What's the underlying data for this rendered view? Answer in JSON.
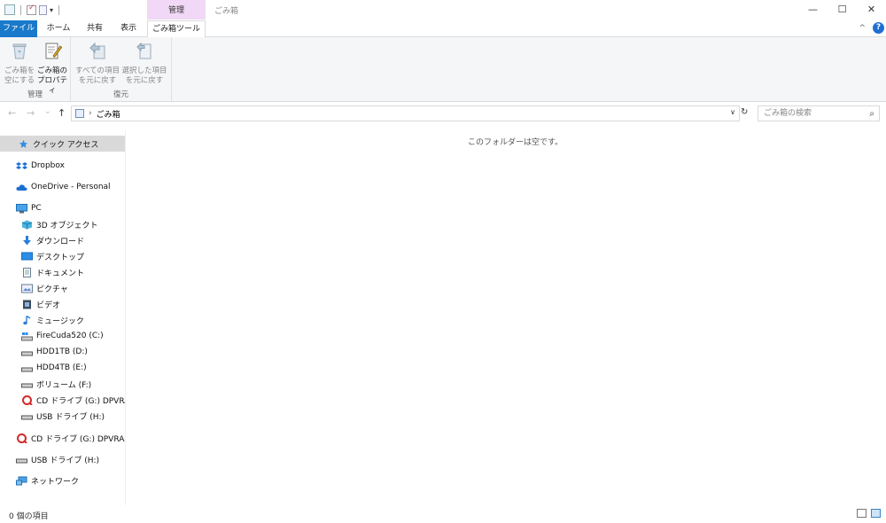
{
  "titlebar": {
    "context_header": "管理",
    "window_title": "ごみ箱",
    "minimize": "—",
    "maximize": "☐",
    "close": "✕"
  },
  "tabs": {
    "file": "ファイル",
    "home": "ホーム",
    "share": "共有",
    "view": "表示",
    "recycle_tools": "ごみ箱ツール",
    "collapse": "^",
    "help": "?"
  },
  "ribbon": {
    "manage": {
      "empty_bin_line1": "ごみ箱を",
      "empty_bin_line2": "空にする",
      "properties_line1": "ごみ箱の",
      "properties_line2": "プロパティ",
      "group_label": "管理"
    },
    "restore": {
      "restore_all_line1": "すべての項目",
      "restore_all_line2": "を元に戻す",
      "restore_selected_line1": "選択した項目",
      "restore_selected_line2": "を元に戻す",
      "group_label": "復元"
    }
  },
  "nav": {
    "back": "←",
    "forward": "→",
    "recent": "⌄",
    "up": "↑",
    "address_sep": "›",
    "address": "ごみ箱",
    "dropdown": "∨",
    "refresh": "↻",
    "search_placeholder": "ごみ箱の検索",
    "search_icon": "⌕"
  },
  "navpane": {
    "quick_access": "クイック アクセス",
    "dropbox": "Dropbox",
    "onedrive": "OneDrive - Personal",
    "pc": "PC",
    "objects3d": "3D オブジェクト",
    "downloads": "ダウンロード",
    "desktop": "デスクトップ",
    "documents": "ドキュメント",
    "pictures": "ピクチャ",
    "videos": "ビデオ",
    "music": "ミュージック",
    "drive_c": "FireCuda520 (C:)",
    "drive_d": "HDD1TB (D:)",
    "drive_e": "HDD4TB (E:)",
    "drive_f": "ボリューム (F:)",
    "drive_g": "CD ドライブ (G:) DPVRAssis",
    "drive_h": "USB ドライブ (H:)",
    "cd_root": "CD ドライブ (G:) DPVRAssista",
    "usb_root": "USB ドライブ (H:)",
    "network": "ネットワーク"
  },
  "content": {
    "empty_message": "このフォルダーは空です。"
  },
  "status": {
    "item_count": "0 個の項目"
  },
  "colors": {
    "file_tab": "#1979ca",
    "context_tab": "#f0d8f6",
    "selected_nav": "#d9d9d9"
  }
}
